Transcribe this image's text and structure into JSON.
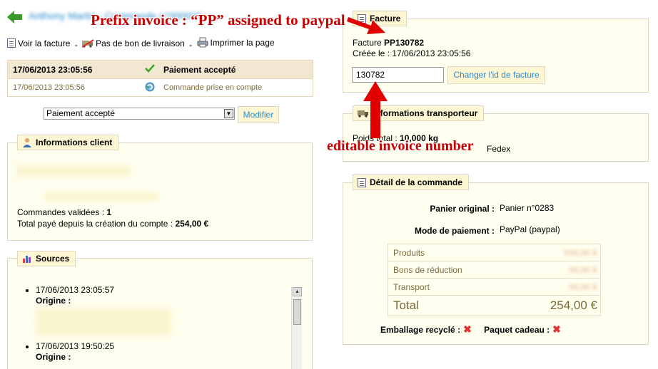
{
  "header": {
    "breadcrumb": "Anthony Martin - Commande n°000000"
  },
  "actions": {
    "view_invoice": "Voir la facture",
    "no_delivery_slip": "Pas de bon de livraison",
    "print_page": "Imprimer la page",
    "separator": "-"
  },
  "history": [
    {
      "date": "17/06/2013 23:05:56",
      "status": "Paiement accepté",
      "icon": "check-icon"
    },
    {
      "date": "17/06/2013 23:05:56",
      "status": "Commande prise en compte",
      "icon": "refresh-icon"
    }
  ],
  "status_form": {
    "selected": "Paiement accepté",
    "button": "Modifier"
  },
  "client": {
    "legend": "Informations client",
    "orders_label": "Commandes validées :",
    "orders_value": "1",
    "total_label": "Total payé depuis la création du compte :",
    "total_value": "254,00 €"
  },
  "sources": {
    "legend": "Sources",
    "entries": [
      {
        "date": "17/06/2013 23:05:57",
        "origin_label": "Origine :"
      },
      {
        "date": "17/06/2013 19:50:25",
        "origin_label": "Origine :"
      }
    ]
  },
  "invoice": {
    "legend": "Facture",
    "label": "Facture",
    "number": "PP130782",
    "created_label": "Créée le :",
    "created_date": "17/06/2013 23:05:56",
    "input_value": "130782",
    "button": "Changer l'id de facture"
  },
  "transport": {
    "legend": "Informations transporteur",
    "weight_label": "Poids total :",
    "weight_value": "10,000 kg",
    "carrier": "Fedex"
  },
  "detail": {
    "legend": "Détail de la commande",
    "cart_label": "Panier original :",
    "cart_value": "Panier n°0283",
    "payment_label": "Mode de paiement :",
    "payment_value": "PayPal (paypal)",
    "rows": [
      {
        "label": "Produits",
        "value": "000,00 €"
      },
      {
        "label": "Bons de réduction",
        "value": "00,00 €"
      },
      {
        "label": "Transport",
        "value": "00,00 €"
      }
    ],
    "total_label": "Total",
    "total_value": "254,00 €",
    "recycled_label": "Emballage recyclé :",
    "gift_label": "Paquet cadeau :"
  },
  "annotations": {
    "prefix_note": "Prefix invoice : “PP” assigned to paypal",
    "editable_note": "editable invoice number",
    "color": "#c80000"
  },
  "colors": {
    "link": "#268ccd",
    "fieldset_bg": "#fffff0",
    "legend_bg": "#fff6d3",
    "history_first_bg": "#f2e8d2"
  }
}
